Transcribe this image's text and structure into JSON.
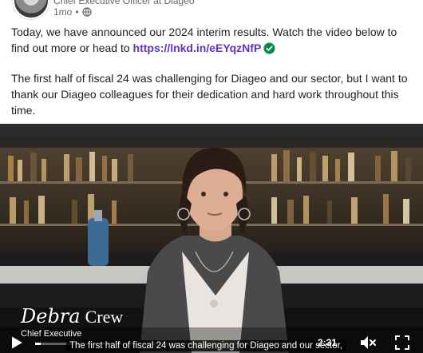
{
  "author": {
    "subtitle": "Chief Executive Officer at Diageo",
    "time_ago": "1mo",
    "separator": "•"
  },
  "post": {
    "p1_text": "Today, we have announced our 2024 interim results. Watch the video below to find out more or head to ",
    "p1_link": "https://lnkd.in/eEYqzNfP",
    "p2_text": "The first half of fiscal 24 was challenging for Diageo and our sector, but I want to thank our Diageo colleagues for their dedication and hard work throughout this time."
  },
  "video": {
    "name_first": "Debra",
    "name_last": "Crew",
    "role": "Chief Executive",
    "caption": "The first half of fiscal 24 was challenging for Diageo and our sector,",
    "time": "2:31",
    "progress": 0.02
  },
  "colors": {
    "link": "#5b35c6",
    "verified": "#0a8a4a"
  },
  "icons": [
    "avatar",
    "globe-icon",
    "check-icon",
    "play-icon",
    "volume-icon",
    "fullscreen-icon"
  ]
}
